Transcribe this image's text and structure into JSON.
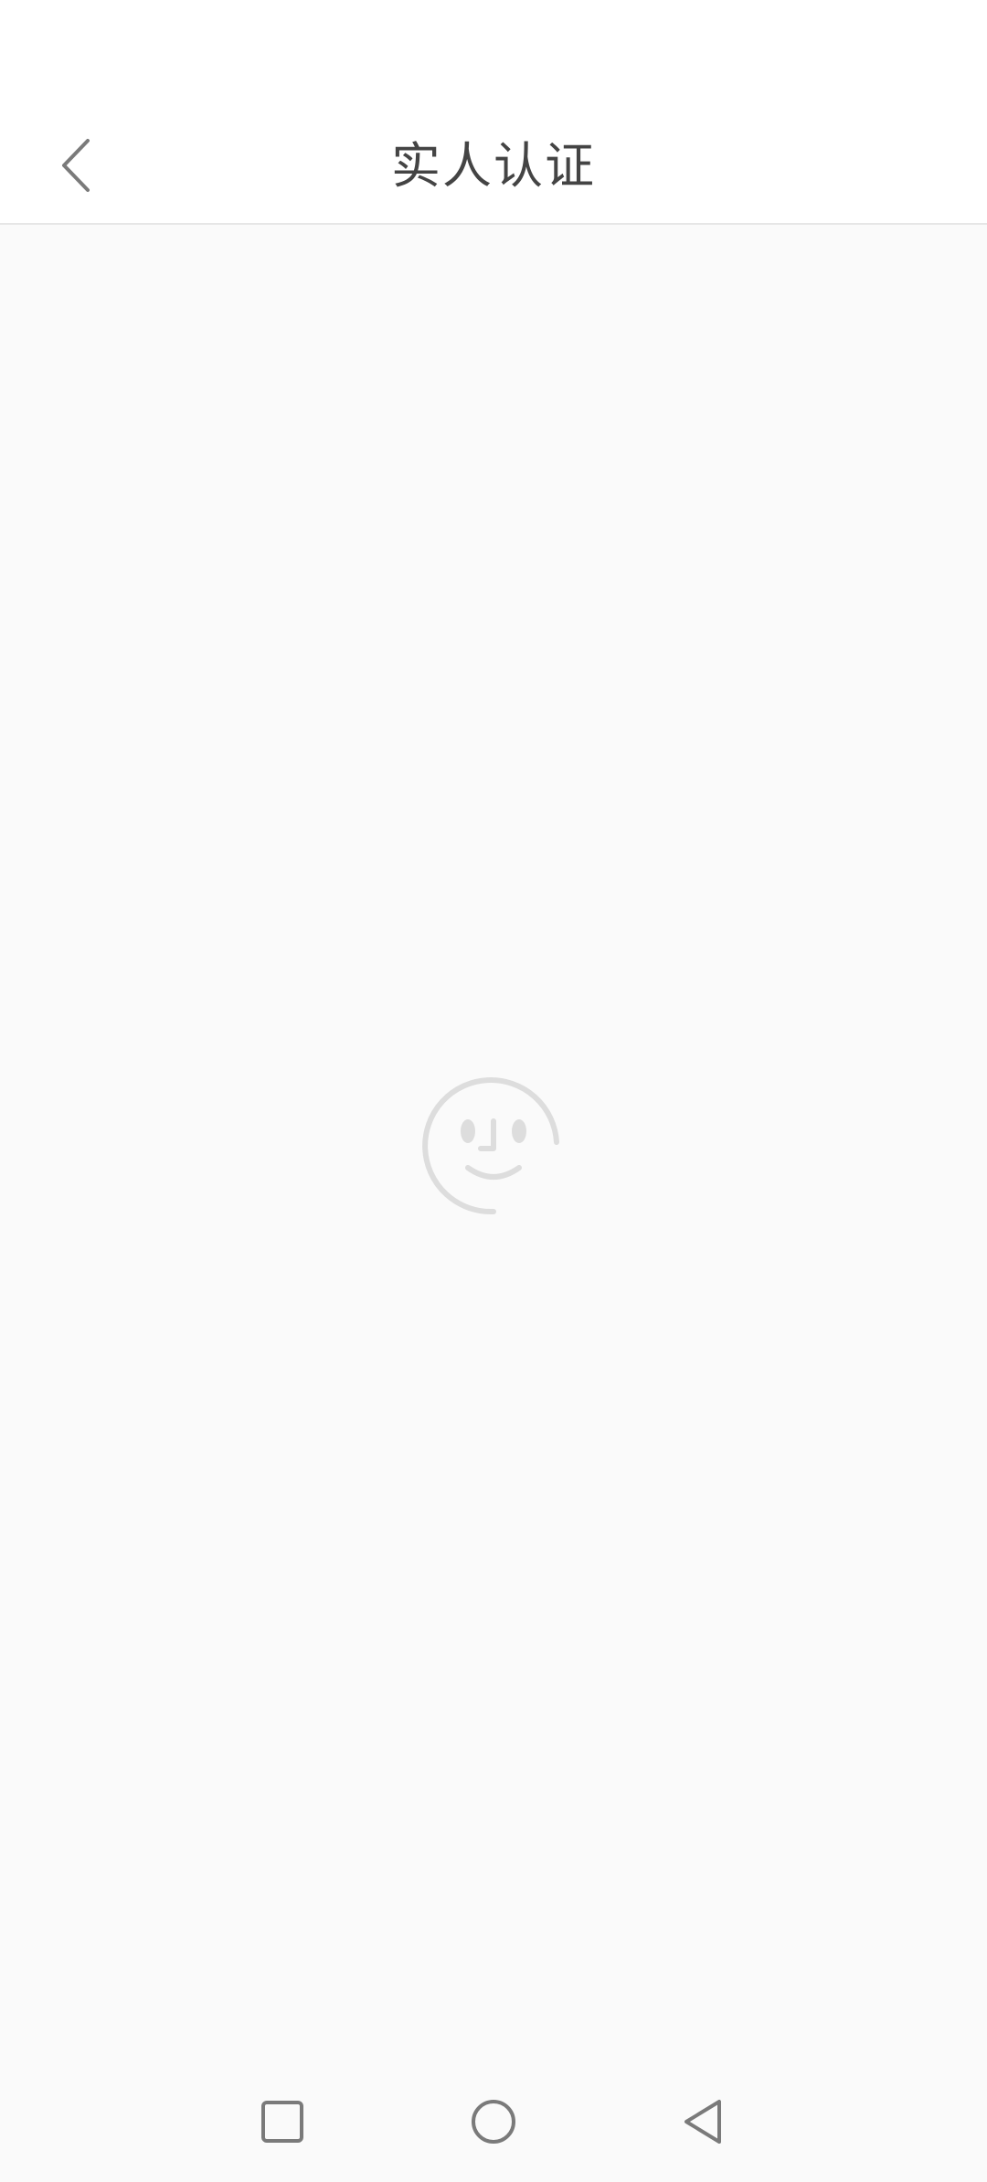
{
  "header": {
    "title": "实人认证"
  },
  "icons": {
    "back": "chevron-left-icon",
    "loading": "face-scan-loading-icon",
    "nav_recent": "square-icon",
    "nav_home": "circle-icon",
    "nav_back": "triangle-back-icon"
  },
  "colors": {
    "title_text": "#444444",
    "icon_gray": "#7a7a7a",
    "loading_gray": "#dddddd",
    "background": "#fafafa",
    "header_background": "#ffffff"
  }
}
